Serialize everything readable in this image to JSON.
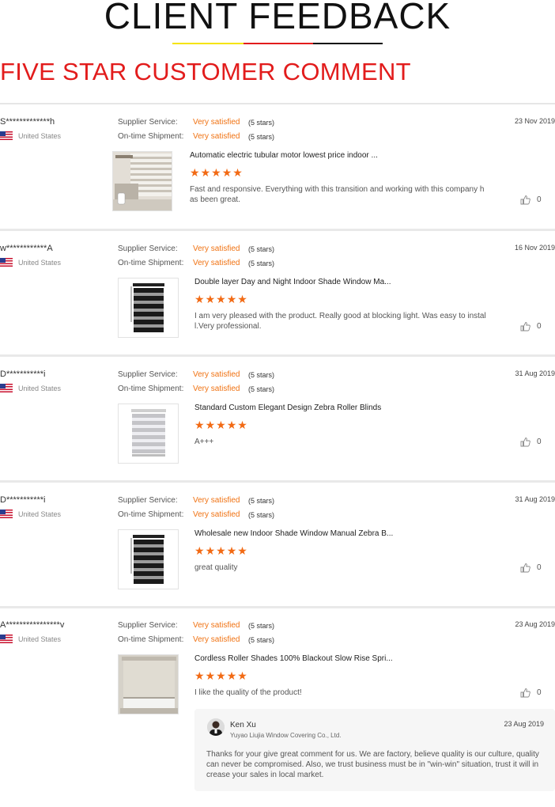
{
  "header": {
    "title": "CLIENT FEEDBACK",
    "subtitle": "FIVE STAR CUSTOMER COMMENT",
    "accent_colors": [
      "#f5e400",
      "#e21c1c",
      "#111111"
    ]
  },
  "labels": {
    "supplier_service": "Supplier Service:",
    "ontime_shipment": "On-time Shipment:",
    "rating_value": "Very satisfied",
    "rating_stars": "(5 stars)"
  },
  "reviews": [
    {
      "user": "S*************h",
      "country": "United States",
      "date": "23 Nov 2019",
      "product_title": "Automatic electric tubular motor lowest price indoor ...",
      "product_rating": 5,
      "comment": "Fast and responsive. Everything with this transition and working with this company has been great.",
      "likes": "0",
      "thumb_icon": "living-room-blinds-photo"
    },
    {
      "user": "w************A",
      "country": "United States",
      "date": "16 Nov 2019",
      "product_title": "Double layer Day and Night Indoor Shade Window Ma...",
      "product_rating": 5,
      "comment": "I am very pleased with the product. Really good at blocking light. Was easy to install.Very professional.",
      "likes": "0",
      "thumb_icon": "black-zebra-blind"
    },
    {
      "user": "D***********i",
      "country": "United States",
      "date": "31 Aug 2019",
      "product_title": "Standard Custom Elegant Design Zebra Roller Blinds",
      "product_rating": 5,
      "comment": "A+++",
      "likes": "0",
      "thumb_icon": "white-zebra-blind"
    },
    {
      "user": "D***********i",
      "country": "United States",
      "date": "31 Aug 2019",
      "product_title": "Wholesale new Indoor Shade Window Manual Zebra B...",
      "product_rating": 5,
      "comment": "great quality",
      "likes": "0",
      "thumb_icon": "black-zebra-blind"
    },
    {
      "user": "A****************v",
      "country": "United States",
      "date": "23 Aug 2019",
      "product_title": "Cordless Roller Shades 100% Blackout Slow Rise Spri...",
      "product_rating": 5,
      "comment": "I like the quality of the product!",
      "likes": "0",
      "thumb_icon": "beige-roller-shade"
    }
  ],
  "reply": {
    "name": "Ken Xu",
    "company": "Yuyao Liujia Window Covering Co., Ltd.",
    "date": "23 Aug 2019",
    "text": "Thanks for your give great comment for us. We are factory,  believe quality is our culture, quality can never be compromised. Also, we trust business must be in \"win-win\" situation, trust it will increase your sales in local market."
  }
}
